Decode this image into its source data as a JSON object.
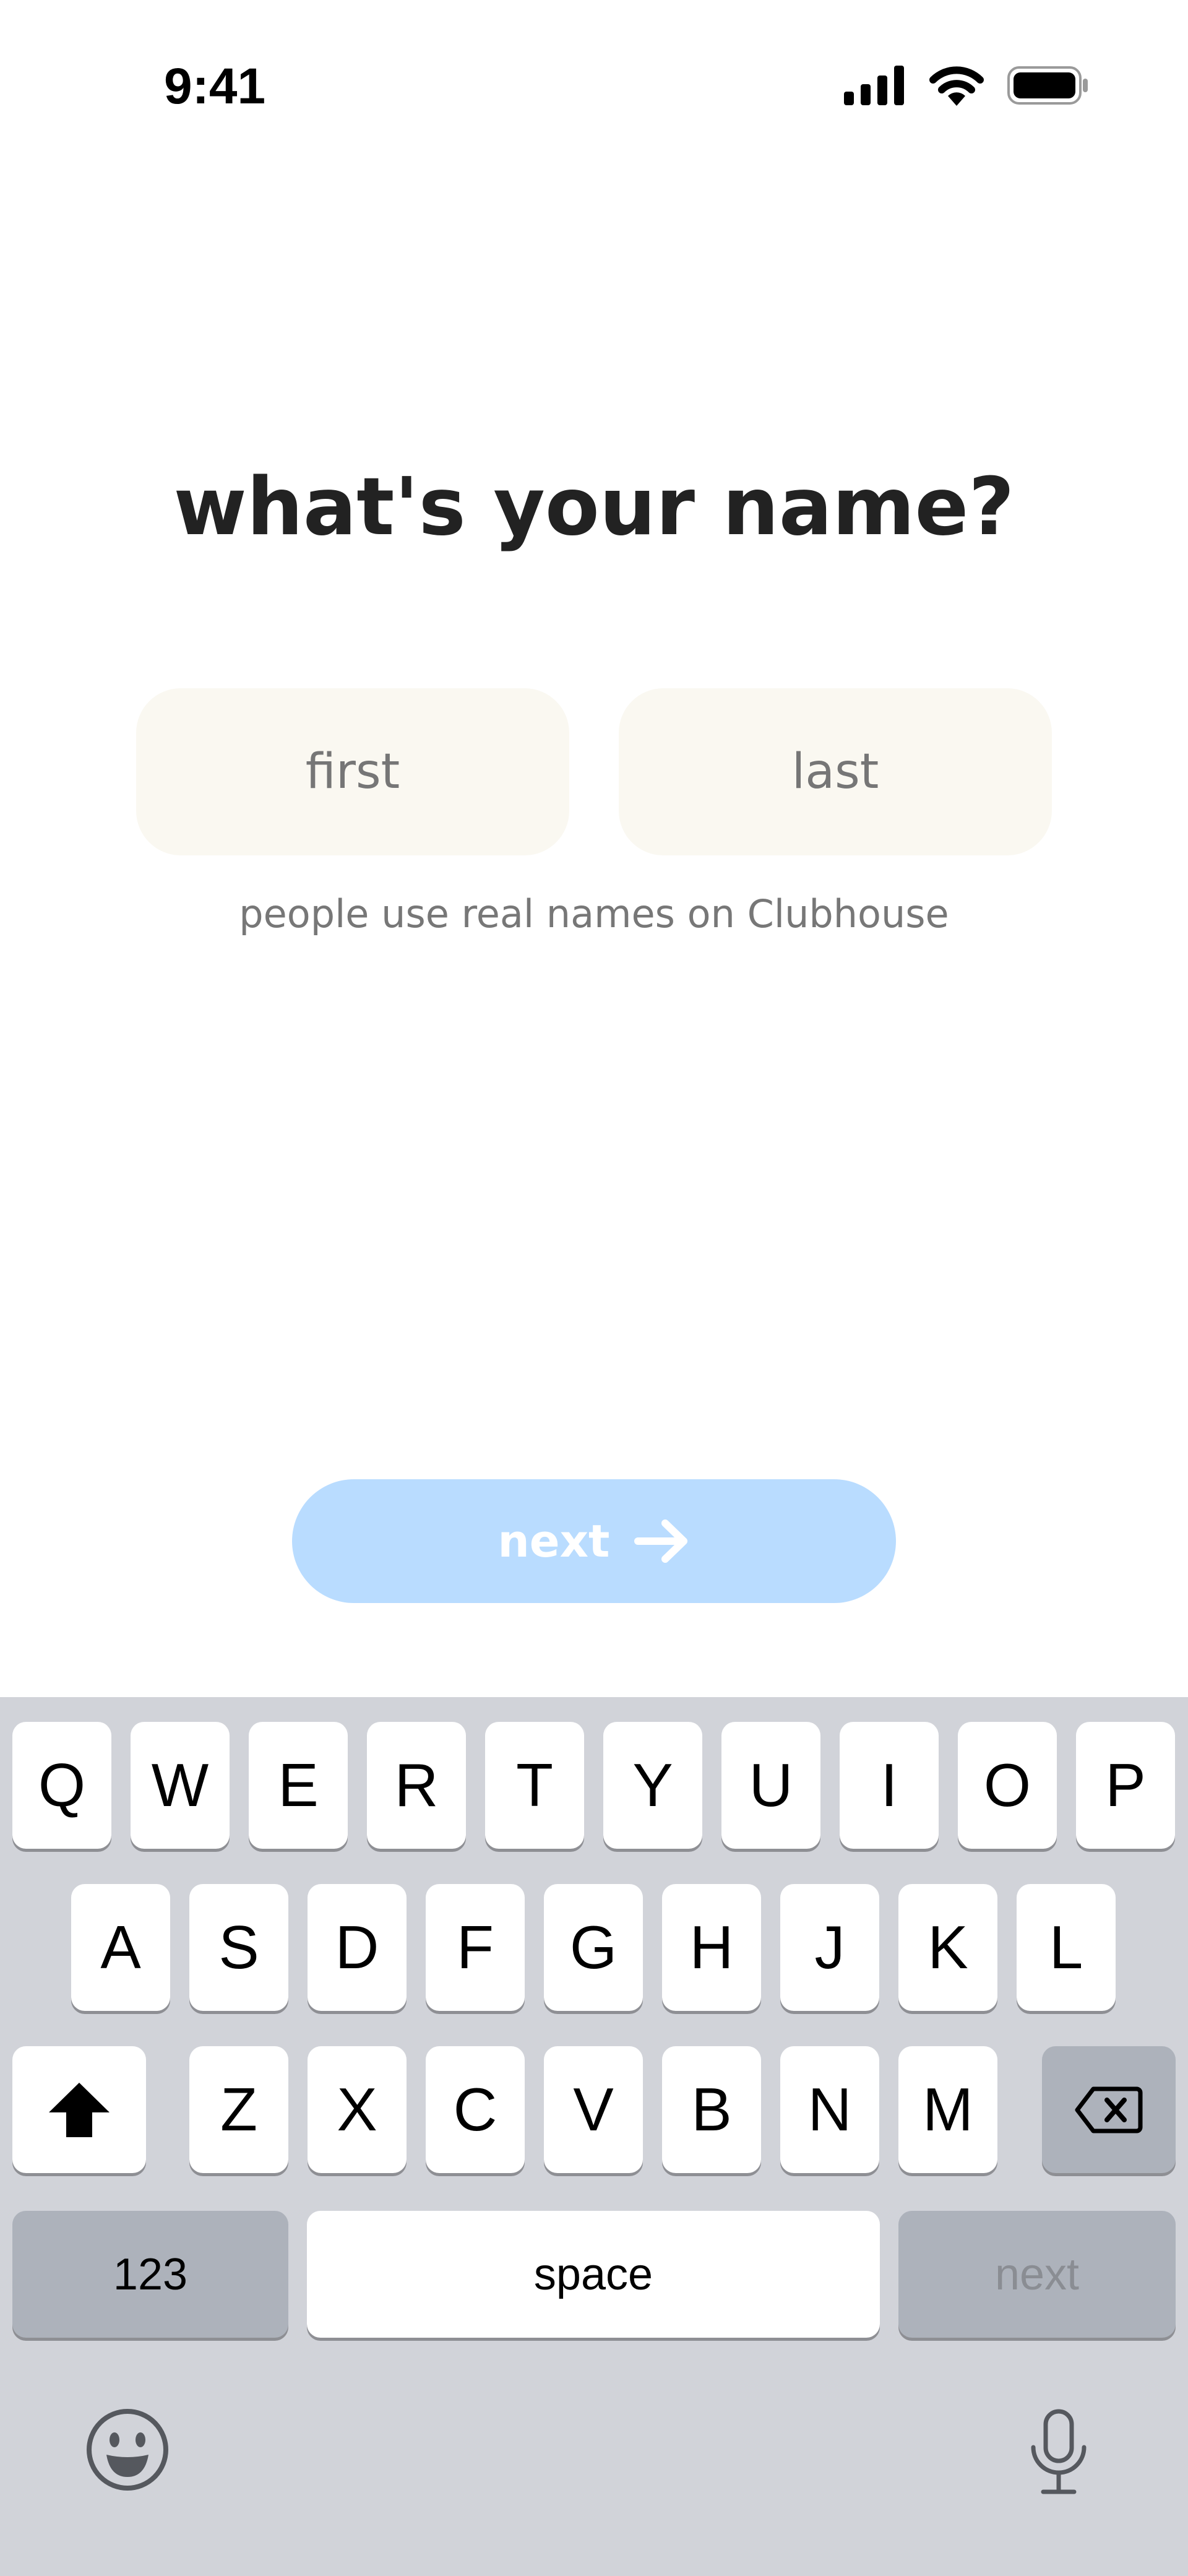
{
  "status_bar": {
    "time": "9:41"
  },
  "screen": {
    "title": "what's your name?",
    "first_placeholder": "first",
    "last_placeholder": "last",
    "hint": "people use real names on Clubhouse",
    "next_label": "next"
  },
  "keyboard": {
    "row1": [
      "Q",
      "W",
      "E",
      "R",
      "T",
      "Y",
      "U",
      "I",
      "O",
      "P"
    ],
    "row2": [
      "A",
      "S",
      "D",
      "F",
      "G",
      "H",
      "J",
      "K",
      "L"
    ],
    "row3": [
      "Z",
      "X",
      "C",
      "V",
      "B",
      "N",
      "M"
    ],
    "numbers_label": "123",
    "space_label": "space",
    "return_label": "next"
  },
  "icons": {
    "signal": "cellular-signal-icon",
    "wifi": "wifi-icon",
    "battery": "battery-icon",
    "arrow": "arrow-right-icon",
    "shift": "shift-icon",
    "delete": "backspace-icon",
    "emoji": "emoji-icon",
    "mic": "microphone-icon"
  },
  "colors": {
    "button_bg": "#b9dcff",
    "input_bg": "#faf8f1",
    "keyboard_bg": "#d1d3d9"
  }
}
